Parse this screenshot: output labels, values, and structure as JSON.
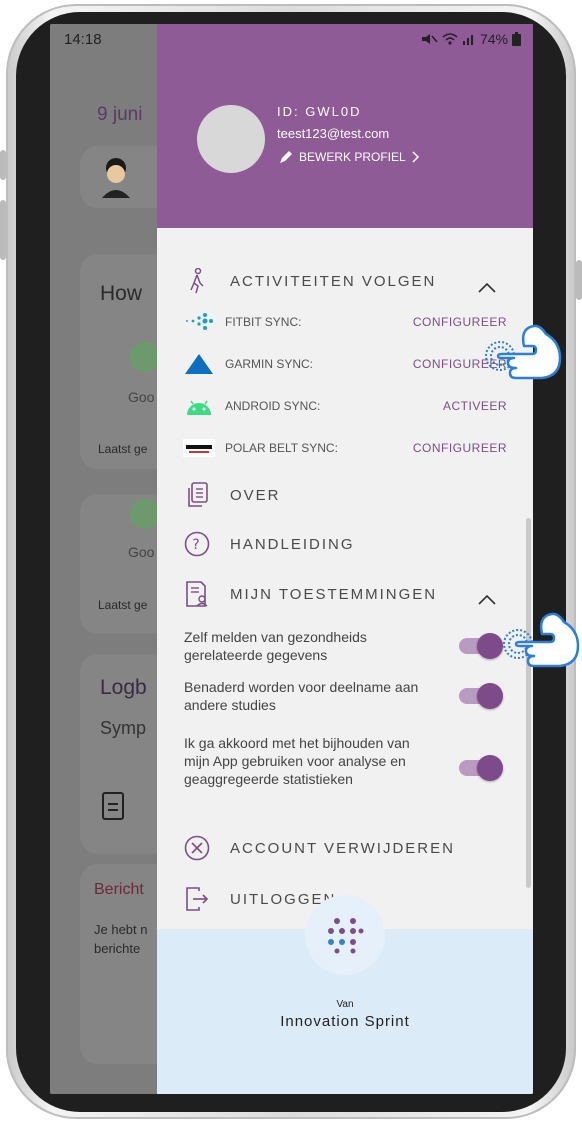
{
  "status_bar": {
    "time": "14:18",
    "battery": "74%"
  },
  "background_app": {
    "date": "9 juni",
    "how_label": "How",
    "good_label_1": "Goo",
    "last_label_1": "Laatst ge",
    "good_label_2": "Goo",
    "last_label_2": "Laatst ge",
    "logbook_label": "Logb",
    "symptom_label": "Symp",
    "messages_label": "Bericht",
    "messages_text_1": "Je hebt n",
    "messages_text_2": "berichte"
  },
  "drawer": {
    "user": {
      "id": "ID: GWL0D",
      "email": "teest123@test.com",
      "edit_profile": "BEWERK PROFIEL"
    },
    "activities": {
      "title": "ACTIVITEITEN VOLGEN",
      "items": [
        {
          "label": "FITBIT SYNC:",
          "action": "CONFIGUREER",
          "icon": "fitbit-logo"
        },
        {
          "label": "GARMIN SYNC:",
          "action": "CONFIGUREER",
          "icon": "garmin-logo"
        },
        {
          "label": "ANDROID SYNC:",
          "action": "ACTIVEER",
          "icon": "android-logo"
        },
        {
          "label": "POLAR BELT SYNC:",
          "action": "CONFIGUREER",
          "icon": "polar-logo"
        }
      ]
    },
    "menu": {
      "about": "OVER",
      "manual": "HANDLEIDING",
      "permissions": "MIJN TOESTEMMINGEN"
    },
    "consents": [
      {
        "text": "Zelf melden van gezondheids gerelateerde gegevens",
        "enabled": true
      },
      {
        "text": "Benaderd worden voor deelname aan andere studies",
        "enabled": true
      },
      {
        "text": "Ik ga akkoord met het bijhouden van mijn App gebruiken voor analyse en geaggregeerde statistieken",
        "enabled": true
      }
    ],
    "delete_account": "ACCOUNT VERWIJDEREN",
    "logout": "UITLOGGEN",
    "footer": {
      "van": "Van",
      "brand": "Innovation Sprint"
    }
  },
  "colors": {
    "accent": "#8e5b96",
    "toggle_on": "#7d4a8a",
    "footer_bg": "#dcebf8"
  }
}
